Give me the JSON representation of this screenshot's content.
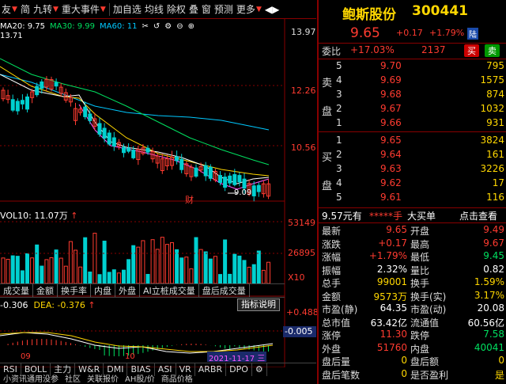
{
  "toolbar": {
    "items": [
      "友",
      "简",
      "九转",
      "重大事件",
      "加自选",
      "均线",
      "除权",
      "叠",
      "窗",
      "预测",
      "更多"
    ]
  },
  "ma": {
    "ma20": "MA20: 9.75",
    "ma30": "MA30: 9.99",
    "ma60": "MA60: 11"
  },
  "price_axis": [
    "13.97",
    "12.26",
    "10.56"
  ],
  "price_hi": "13.71",
  "price_lo": "9.09",
  "event_marker": "财",
  "vol": {
    "label": "VOL10: 11.07万",
    "axis": [
      "53149",
      "26895",
      "X10"
    ]
  },
  "vol_tabs": [
    "成交量",
    "金额",
    "换手率",
    "内盘",
    "外盘",
    "AI立桩成交量",
    "盘后成交量"
  ],
  "macd": {
    "diff": "-0.306",
    "dea": "DEA: -0.376",
    "btn": "指标说明",
    "axis": [
      "+0.488",
      "-0.005"
    ],
    "dates": [
      "09",
      "10"
    ],
    "cursor_date": "2021-11-17 三"
  },
  "tabs1": [
    "RSI",
    "BOLL",
    "主力",
    "W&R",
    "DMI",
    "BIAS",
    "ASI",
    "VR",
    "ARBR",
    "DPO"
  ],
  "tabs2": [
    "小资讯通用没参",
    "社区",
    "关联报价",
    "AH股/价",
    "商品价格"
  ],
  "stock": {
    "name": "鲍斯股份",
    "code": "300441",
    "price": "9.65",
    "change": "+0.17",
    "pct": "+1.79%",
    "tag": "陆"
  },
  "weibi": {
    "label": "委比",
    "value": "+17.03%",
    "diff": "2137",
    "buy": "买",
    "sell": "卖"
  },
  "sell_orders": [
    {
      "n": "5",
      "p": "9.70",
      "v": "795"
    },
    {
      "n": "4",
      "p": "9.69",
      "v": "1575"
    },
    {
      "n": "3",
      "p": "9.68",
      "v": "874"
    },
    {
      "n": "2",
      "p": "9.67",
      "v": "1032"
    },
    {
      "n": "1",
      "p": "9.66",
      "v": "931"
    }
  ],
  "buy_orders": [
    {
      "n": "1",
      "p": "9.65",
      "v": "3824"
    },
    {
      "n": "2",
      "p": "9.64",
      "v": "161"
    },
    {
      "n": "3",
      "p": "9.63",
      "v": "3226"
    },
    {
      "n": "4",
      "p": "9.62",
      "v": "17"
    },
    {
      "n": "5",
      "p": "9.61",
      "v": "116"
    }
  ],
  "side_labels": {
    "sell1": "卖",
    "sell2": "盘",
    "buy1": "买",
    "buy2": "盘"
  },
  "big": {
    "price": "9.57元有",
    "stars": "*****手",
    "label": "大买单",
    "link": "点击查看"
  },
  "stats": [
    {
      "l1": "最新",
      "v1": "9.65",
      "c1": "red",
      "l2": "开盘",
      "v2": "9.49",
      "c2": "red"
    },
    {
      "l1": "涨跌",
      "v1": "+0.17",
      "c1": "red",
      "l2": "最高",
      "v2": "9.67",
      "c2": "red"
    },
    {
      "l1": "涨幅",
      "v1": "+1.79%",
      "c1": "red",
      "l2": "最低",
      "v2": "9.45",
      "c2": "green"
    },
    {
      "l1": "振幅",
      "v1": "2.32%",
      "c1": "white",
      "l2": "量比",
      "v2": "0.82",
      "c2": "white"
    },
    {
      "l1": "总手",
      "v1": "99001",
      "c1": "yellow",
      "l2": "换手",
      "v2": "1.59%",
      "c2": "yellow"
    },
    {
      "l1": "金额",
      "v1": "9573万",
      "c1": "yellow",
      "l2": "换手(实)",
      "v2": "3.17%",
      "c2": "yellow"
    },
    {
      "l1": "市盈(静)",
      "v1": "64.35",
      "c1": "white",
      "l2": "市盈(动)",
      "v2": "20.08",
      "c2": "white"
    },
    {
      "l1": "总市值",
      "v1": "63.42亿",
      "c1": "white",
      "l2": "流通值",
      "v2": "60.56亿",
      "c2": "white"
    },
    {
      "l1": "涨停",
      "v1": "11.30",
      "c1": "red",
      "l2": "跌停",
      "v2": "7.58",
      "c2": "green"
    },
    {
      "l1": "外盘",
      "v1": "51760",
      "c1": "red",
      "l2": "内盘",
      "v2": "40041",
      "c2": "green"
    },
    {
      "l1": "盘后量",
      "v1": "0",
      "c1": "yellow",
      "l2": "盘后额",
      "v2": "0",
      "c2": "yellow"
    },
    {
      "l1": "盘后笔数",
      "v1": "0",
      "c1": "yellow",
      "l2": "是否盈利",
      "v2": "是",
      "c2": "yellow"
    }
  ]
}
